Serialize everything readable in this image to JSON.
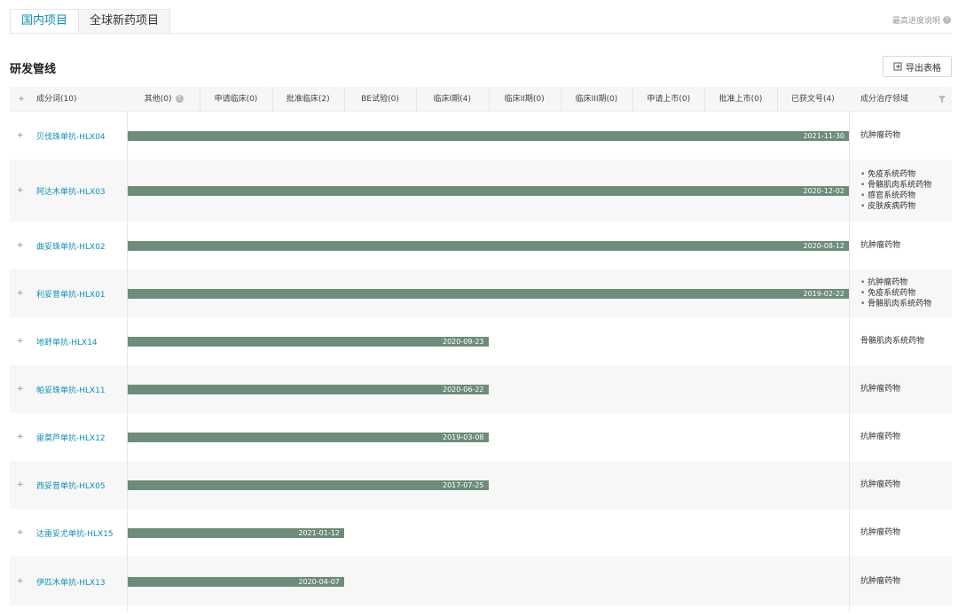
{
  "tabs": [
    {
      "label": "国内项目",
      "active": true
    },
    {
      "label": "全球新药项目",
      "active": false
    }
  ],
  "progress_note": "最高进度说明",
  "section_title": "研发管线",
  "export_label": "导出表格",
  "colors": {
    "accent": "#0e8fb8",
    "bar": "#6d8c7a"
  },
  "columns": {
    "ingredient": "成分词(10)",
    "phases": [
      "其他(0)",
      "申请临床(0)",
      "批准临床(2)",
      "BE试验(0)",
      "临床I期(4)",
      "临床II期(0)",
      "临床III期(0)",
      "申请上市(0)",
      "批准上市(0)",
      "已获文号(4)"
    ],
    "therapy": "成分治疗领域"
  },
  "rows": [
    {
      "name": "贝伐珠单抗-HLX04",
      "date": "2021-11-30",
      "stage_index": 9,
      "therapy": [
        "抗肿瘤药物"
      ],
      "therapy_list": false
    },
    {
      "name": "阿达木单抗-HLX03",
      "date": "2020-12-02",
      "stage_index": 9,
      "therapy": [
        "免疫系统药物",
        "骨骼肌肉系统药物",
        "感官系统药物",
        "皮肤疾病药物"
      ],
      "therapy_list": true
    },
    {
      "name": "曲妥珠单抗-HLX02",
      "date": "2020-08-12",
      "stage_index": 9,
      "therapy": [
        "抗肿瘤药物"
      ],
      "therapy_list": false
    },
    {
      "name": "利妥昔单抗-HLX01",
      "date": "2019-02-22",
      "stage_index": 9,
      "therapy": [
        "抗肿瘤药物",
        "免疫系统药物",
        "骨骼肌肉系统药物"
      ],
      "therapy_list": true
    },
    {
      "name": "地舒单抗-HLX14",
      "date": "2020-09-23",
      "stage_index": 4,
      "therapy": [
        "骨骼肌肉系统药物"
      ],
      "therapy_list": false
    },
    {
      "name": "帕妥珠单抗-HLX11",
      "date": "2020-06-22",
      "stage_index": 4,
      "therapy": [
        "抗肿瘤药物"
      ],
      "therapy_list": false
    },
    {
      "name": "雷莫芦单抗-HLX12",
      "date": "2019-03-08",
      "stage_index": 4,
      "therapy": [
        "抗肿瘤药物"
      ],
      "therapy_list": false
    },
    {
      "name": "西妥昔单抗-HLX05",
      "date": "2017-07-25",
      "stage_index": 4,
      "therapy": [
        "抗肿瘤药物"
      ],
      "therapy_list": false
    },
    {
      "name": "达雷妥尤单抗-HLX15",
      "date": "2021-01-12",
      "stage_index": 2,
      "therapy": [
        "抗肿瘤药物"
      ],
      "therapy_list": false
    },
    {
      "name": "伊匹木单抗-HLX13",
      "date": "2020-04-07",
      "stage_index": 2,
      "therapy": [
        "抗肿瘤药物"
      ],
      "therapy_list": false
    }
  ]
}
